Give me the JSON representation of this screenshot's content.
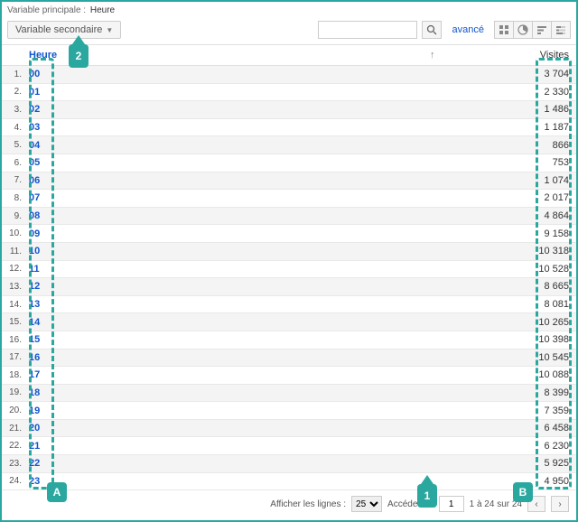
{
  "topbar": {
    "primary_label": "Variable principale :",
    "primary_value": "Heure"
  },
  "controls": {
    "secondary_label": "Variable secondaire",
    "advanced": "avancé",
    "search_placeholder": ""
  },
  "header": {
    "hour": "Heure",
    "visits": "Visites",
    "sort_arrow": "↑"
  },
  "rows": [
    {
      "idx": "1.",
      "hour": "00",
      "visits": "3 704"
    },
    {
      "idx": "2.",
      "hour": "01",
      "visits": "2 330"
    },
    {
      "idx": "3.",
      "hour": "02",
      "visits": "1 486"
    },
    {
      "idx": "4.",
      "hour": "03",
      "visits": "1 187"
    },
    {
      "idx": "5.",
      "hour": "04",
      "visits": "866"
    },
    {
      "idx": "6.",
      "hour": "05",
      "visits": "753"
    },
    {
      "idx": "7.",
      "hour": "06",
      "visits": "1 074"
    },
    {
      "idx": "8.",
      "hour": "07",
      "visits": "2 017"
    },
    {
      "idx": "9.",
      "hour": "08",
      "visits": "4 864"
    },
    {
      "idx": "10.",
      "hour": "09",
      "visits": "9 158"
    },
    {
      "idx": "11.",
      "hour": "10",
      "visits": "10 318"
    },
    {
      "idx": "12.",
      "hour": "11",
      "visits": "10 528"
    },
    {
      "idx": "13.",
      "hour": "12",
      "visits": "8 665"
    },
    {
      "idx": "14.",
      "hour": "13",
      "visits": "8 081"
    },
    {
      "idx": "15.",
      "hour": "14",
      "visits": "10 265"
    },
    {
      "idx": "16.",
      "hour": "15",
      "visits": "10 398"
    },
    {
      "idx": "17.",
      "hour": "16",
      "visits": "10 545"
    },
    {
      "idx": "18.",
      "hour": "17",
      "visits": "10 088"
    },
    {
      "idx": "19.",
      "hour": "18",
      "visits": "8 399"
    },
    {
      "idx": "20.",
      "hour": "19",
      "visits": "7 359"
    },
    {
      "idx": "21.",
      "hour": "20",
      "visits": "6 458"
    },
    {
      "idx": "22.",
      "hour": "21",
      "visits": "6 230"
    },
    {
      "idx": "23.",
      "hour": "22",
      "visits": "5 925"
    },
    {
      "idx": "24.",
      "hour": "23",
      "visits": "4 950"
    }
  ],
  "pager": {
    "show_label": "Afficher les lignes :",
    "show_value": "25",
    "goto_label": "Accéder à :",
    "goto_value": "1",
    "range": "1 à 24 sur 24",
    "prev": "‹",
    "next": "›"
  },
  "badges": {
    "one": "1",
    "two": "2",
    "a": "A",
    "b": "B"
  }
}
